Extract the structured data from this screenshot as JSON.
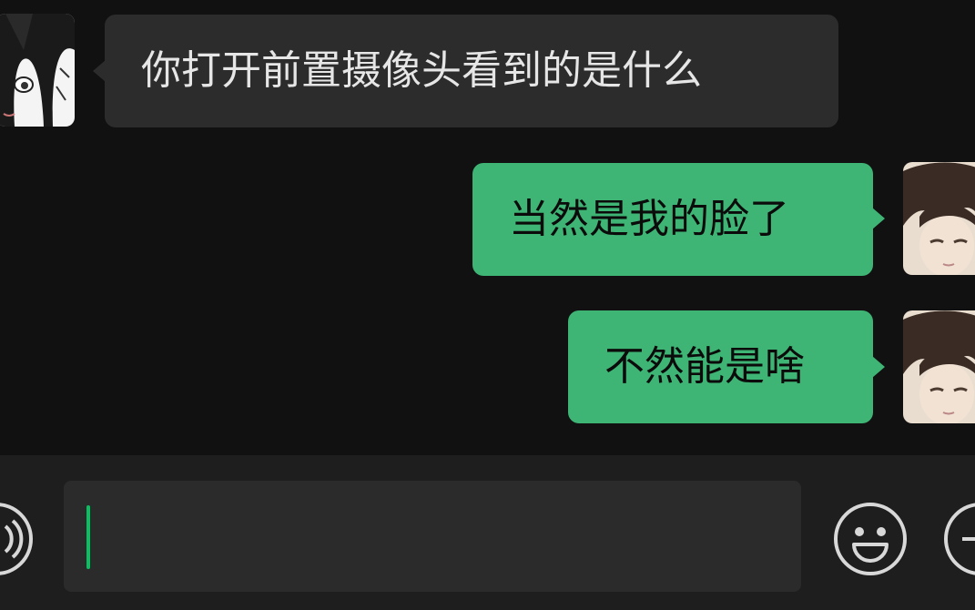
{
  "messages": [
    {
      "direction": "incoming",
      "text": "你打开前置摄像头看到的是什么",
      "avatar": "anime-girl-avatar"
    },
    {
      "direction": "outgoing",
      "text": "当然是我的脸了",
      "avatar": "anime-boy-avatar"
    },
    {
      "direction": "outgoing",
      "text": "不然能是啥",
      "avatar": "anime-boy-avatar"
    }
  ],
  "input": {
    "value": ""
  },
  "icons": {
    "voice": "voice-icon",
    "emoji": "emoji-icon",
    "add": "plus-icon"
  },
  "colors": {
    "outgoing_bubble": "#3eb575",
    "incoming_bubble": "#2c2c2c",
    "caret": "#07c160",
    "background": "#111111"
  }
}
